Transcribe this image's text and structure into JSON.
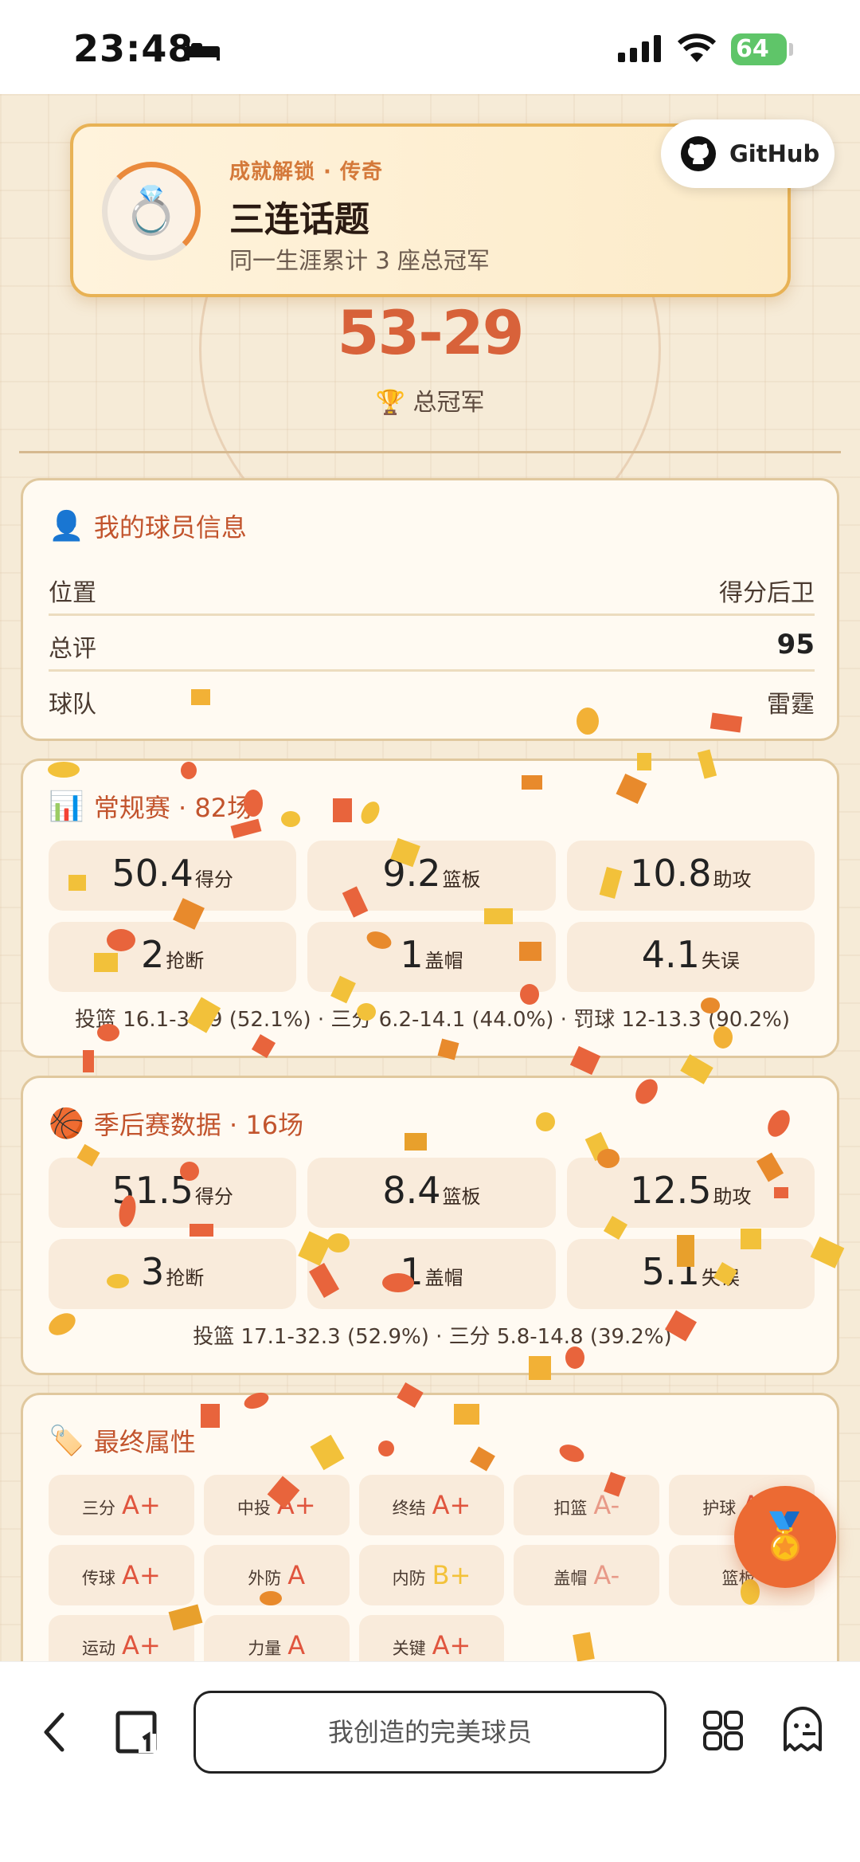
{
  "status_bar": {
    "time": "23:48",
    "battery": "64"
  },
  "toast": {
    "kicker": "成就解锁 · 传奇",
    "title": "三连话题",
    "desc": "同一生涯累计 3 座总冠军",
    "icon": "ring-icon"
  },
  "github": {
    "label": "GitHub"
  },
  "season_summary": {
    "record": "53-29",
    "result": "总冠军",
    "result_icon": "trophy-icon"
  },
  "player_info": {
    "title": "我的球员信息",
    "rows": [
      {
        "key": "位置",
        "value": "得分后卫"
      },
      {
        "key": "总评",
        "value": "95"
      },
      {
        "key": "球队",
        "value": "雷霆"
      }
    ]
  },
  "regular_season": {
    "title": "常规赛 · 82场",
    "stats": [
      {
        "num": "50.4",
        "unit": "得分"
      },
      {
        "num": "9.2",
        "unit": "篮板"
      },
      {
        "num": "10.8",
        "unit": "助攻"
      },
      {
        "num": "2",
        "unit": "抢断"
      },
      {
        "num": "1",
        "unit": "盖帽"
      },
      {
        "num": "4.1",
        "unit": "失误"
      }
    ],
    "shooting": "投篮 16.1-30.9 (52.1%) · 三分 6.2-14.1 (44.0%) · 罚球 12-13.3 (90.2%)"
  },
  "playoffs": {
    "title": "季后赛数据 · 16场",
    "stats": [
      {
        "num": "51.5",
        "unit": "得分"
      },
      {
        "num": "8.4",
        "unit": "篮板"
      },
      {
        "num": "12.5",
        "unit": "助攻"
      },
      {
        "num": "3",
        "unit": "抢断"
      },
      {
        "num": "1",
        "unit": "盖帽"
      },
      {
        "num": "5.1",
        "unit": "失误"
      }
    ],
    "shooting": "投篮 17.1-32.3 (52.9%) · 三分 5.8-14.8 (39.2%)"
  },
  "attributes": {
    "title": "最终属性",
    "items": [
      {
        "name": "三分",
        "grade": "A+"
      },
      {
        "name": "中投",
        "grade": "A+"
      },
      {
        "name": "终结",
        "grade": "A+"
      },
      {
        "name": "扣篮",
        "grade": "A-"
      },
      {
        "name": "护球",
        "grade": "A+"
      },
      {
        "name": "传球",
        "grade": "A+"
      },
      {
        "name": "外防",
        "grade": "A"
      },
      {
        "name": "内防",
        "grade": "B+"
      },
      {
        "name": "盖帽",
        "grade": "A-"
      },
      {
        "name": "篮板",
        "grade": ""
      },
      {
        "name": "运动",
        "grade": "A+"
      },
      {
        "name": "力量",
        "grade": "A"
      },
      {
        "name": "关键",
        "grade": "A+"
      }
    ]
  },
  "fab": {
    "icon": "medal-icon"
  },
  "browser": {
    "url_text": "我创造的完美球员"
  },
  "colors": {
    "accent": "#d8623a",
    "grade_a": "#e0553e",
    "grade_b": "#f3c23a",
    "page_bg": "#f6ebd7"
  }
}
